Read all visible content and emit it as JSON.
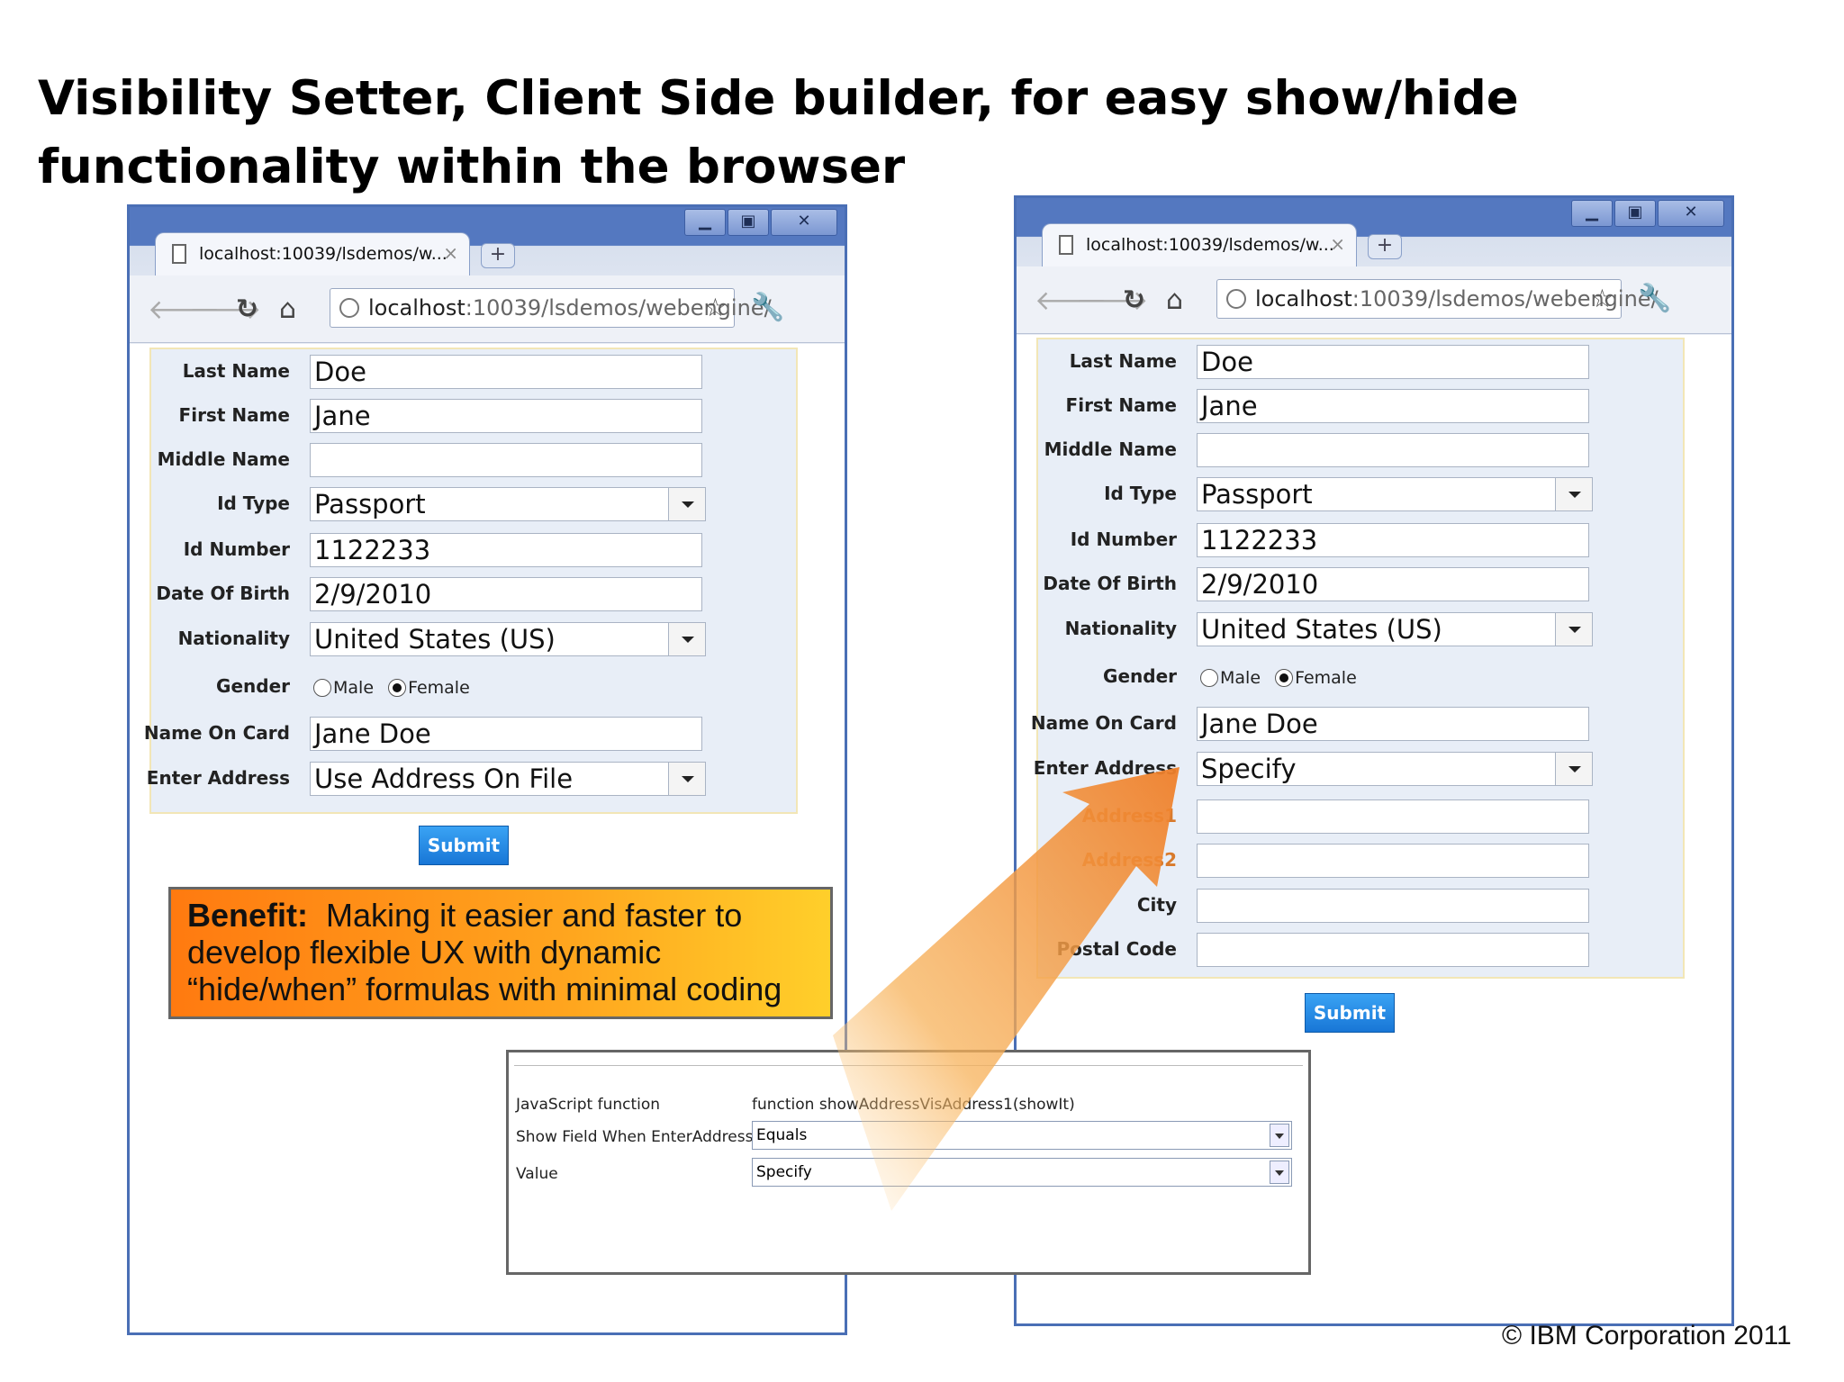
{
  "slide": {
    "title": "Visibility Setter, Client Side builder, for easy show/hide functionality within the browser",
    "copyright": "© IBM Corporation 2011"
  },
  "browser": {
    "tab_title": "localhost:10039/lsdemos/w...",
    "tab_close": "×",
    "new_tab": "+",
    "url_host": "localhost",
    "url_rest": ":10039/lsdemos/webengine/",
    "window_controls": {
      "minimize": "▁",
      "maximize": "▣",
      "close": "✕"
    },
    "icons": {
      "back": "back-arrow-icon",
      "forward": "forward-arrow-icon",
      "reload": "reload-icon",
      "home": "home-icon",
      "star": "bookmark-star-icon",
      "wrench": "wrench-icon"
    }
  },
  "left_form": {
    "fields": {
      "last_name": {
        "label": "Last Name",
        "value": "Doe"
      },
      "first_name": {
        "label": "First Name",
        "value": "Jane"
      },
      "middle_name": {
        "label": "Middle Name",
        "value": ""
      },
      "id_type": {
        "label": "Id Type",
        "value": "Passport"
      },
      "id_number": {
        "label": "Id Number",
        "value": "1122233"
      },
      "dob": {
        "label": "Date Of Birth",
        "value": "2/9/2010"
      },
      "nationality": {
        "label": "Nationality",
        "value": "United States (US)"
      },
      "gender": {
        "label": "Gender",
        "male": "Male",
        "female": "Female",
        "selected": "Female"
      },
      "name_on_card": {
        "label": "Name On Card",
        "value": "Jane Doe"
      },
      "enter_address": {
        "label": "Enter Address",
        "value": "Use Address On File"
      }
    },
    "submit": "Submit"
  },
  "right_form": {
    "fields": {
      "last_name": {
        "label": "Last Name",
        "value": "Doe"
      },
      "first_name": {
        "label": "First Name",
        "value": "Jane"
      },
      "middle_name": {
        "label": "Middle Name",
        "value": ""
      },
      "id_type": {
        "label": "Id Type",
        "value": "Passport"
      },
      "id_number": {
        "label": "Id Number",
        "value": "1122233"
      },
      "dob": {
        "label": "Date Of Birth",
        "value": "2/9/2010"
      },
      "nationality": {
        "label": "Nationality",
        "value": "United States (US)"
      },
      "gender": {
        "label": "Gender",
        "male": "Male",
        "female": "Female",
        "selected": "Female"
      },
      "name_on_card": {
        "label": "Name On Card",
        "value": "Jane Doe"
      },
      "enter_address": {
        "label": "Enter Address",
        "value": "Specify"
      },
      "address1": {
        "label": "Address1",
        "value": ""
      },
      "address2": {
        "label": "Address2",
        "value": ""
      },
      "city": {
        "label": "City",
        "value": ""
      },
      "postal_code": {
        "label": "Postal Code",
        "value": ""
      }
    },
    "submit": "Submit"
  },
  "benefit": {
    "lead": "Benefit:",
    "text": "Making it easier and faster to develop flexible UX with dynamic “hide/when” formulas with minimal coding"
  },
  "config": {
    "js_label": "JavaScript function",
    "js_value": "function showAddressVisAddress1(showIt)",
    "show_label": "Show Field When EnterAddress",
    "show_value": "Equals",
    "value_label": "Value",
    "value_value": "Specify"
  },
  "colors": {
    "window_border": "#4a6fb5",
    "form_bg": "#e8eef7",
    "submit": "#1e88e5",
    "callout_start": "#ff7a10",
    "callout_end": "#ffcf2a",
    "arrow": "#f08a2a"
  }
}
